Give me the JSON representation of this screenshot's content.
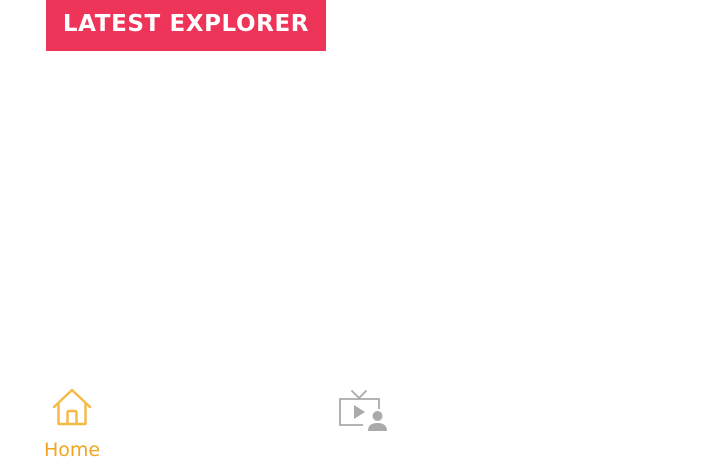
{
  "header": {
    "title": "LATEST EXPLORER"
  },
  "bottom_nav": {
    "items": [
      {
        "label": "Home",
        "icon": "home-icon",
        "active": true
      },
      {
        "label": "",
        "icon": "video-explorer-icon",
        "active": false
      }
    ]
  },
  "colors": {
    "banner": "#ee3459",
    "active_nav": "#f2a51f",
    "inactive_nav": "#aaaaaa",
    "background": "#ffffff"
  }
}
